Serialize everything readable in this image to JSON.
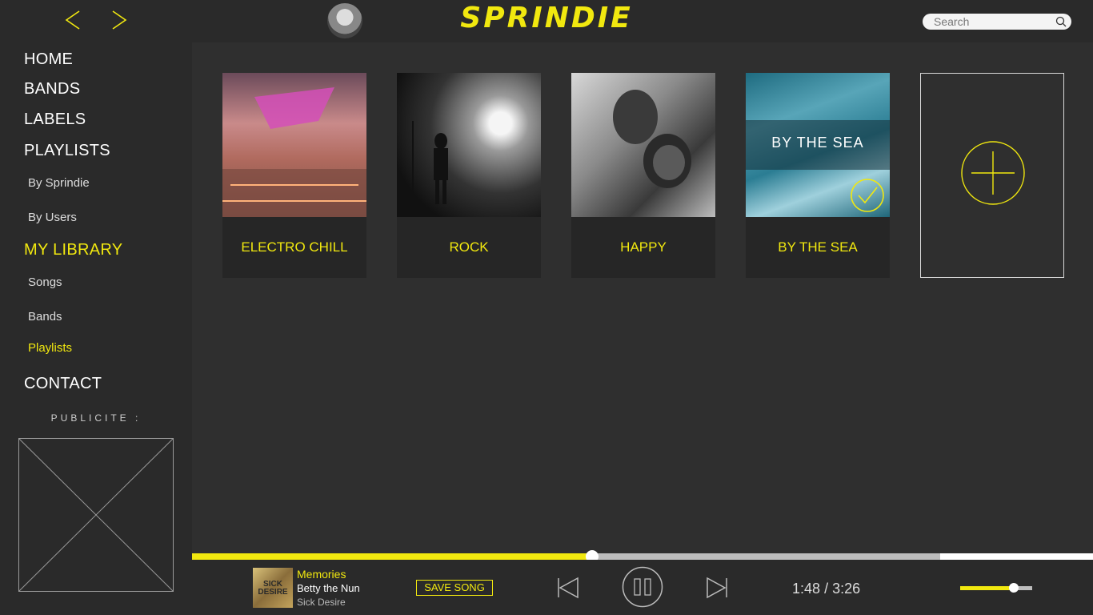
{
  "header": {
    "logo": "SPRINDIE",
    "search_placeholder": "Search"
  },
  "sidebar": {
    "items": [
      {
        "label": "HOME"
      },
      {
        "label": "BANDS"
      },
      {
        "label": "LABELS"
      },
      {
        "label": "PLAYLISTS"
      },
      {
        "label": "By Sprindie"
      },
      {
        "label": "By Users"
      },
      {
        "label": "MY LIBRARY"
      },
      {
        "label": "Songs"
      },
      {
        "label": "Bands"
      },
      {
        "label": "Playlists"
      },
      {
        "label": "CONTACT"
      }
    ],
    "ad_label": "PUBLICITE :"
  },
  "playlists": [
    {
      "title": "ELECTRO CHILL"
    },
    {
      "title": "ROCK"
    },
    {
      "title": "HAPPY"
    },
    {
      "title": "BY THE SEA",
      "overlay_label": "BY THE SEA",
      "selected": true
    }
  ],
  "player": {
    "song_title": "Memories",
    "band": "Betty the Nun",
    "album": "Sick Desire",
    "cover_text": "SICK DESIRE",
    "save_label": "SAVE SONG",
    "current_time": "1:48",
    "separator": "/",
    "total_time": "3:26",
    "progress_fraction": 0.524,
    "volume_fraction": 0.74
  },
  "colors": {
    "accent": "#f1e80f",
    "background": "#2f2f2f",
    "panel": "#2a2a2a"
  }
}
